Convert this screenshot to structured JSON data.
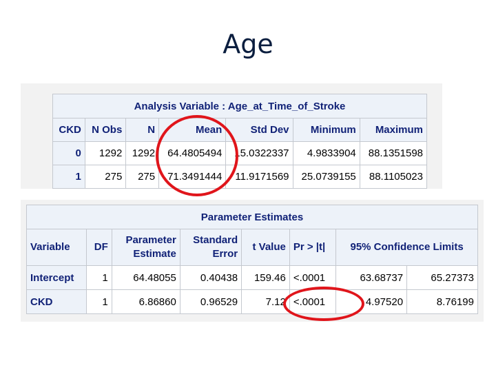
{
  "title": "Age",
  "table1": {
    "caption": "Analysis Variable : Age_at_Time_of_Stroke",
    "headers": [
      "CKD",
      "N Obs",
      "N",
      "Mean",
      "Std Dev",
      "Minimum",
      "Maximum"
    ],
    "rows": [
      [
        "0",
        "1292",
        "1292",
        "64.4805494",
        "15.0322337",
        "4.9833904",
        "88.1351598"
      ],
      [
        "1",
        "275",
        "275",
        "71.3491444",
        "11.9171569",
        "25.0739155",
        "88.1105023"
      ]
    ]
  },
  "table2": {
    "caption": "Parameter Estimates",
    "headers": {
      "variable": "Variable",
      "df": "DF",
      "param_line1": "Parameter",
      "param_line2": "Estimate",
      "se_line1": "Standard",
      "se_line2": "Error",
      "tvalue": "t Value",
      "pr": "Pr > |t|",
      "ci": "95% Confidence Limits"
    },
    "rows": [
      [
        "Intercept",
        "1",
        "64.48055",
        "0.40438",
        "159.46",
        "<.0001",
        "63.68737",
        "65.27373"
      ],
      [
        "CKD",
        "1",
        "6.86860",
        "0.96529",
        "7.12",
        "<.0001",
        "4.97520",
        "8.76199"
      ]
    ]
  },
  "colors": {
    "highlight_circle": "#e0151b",
    "header_bg": "#edf2f9",
    "header_text": "#112277"
  }
}
